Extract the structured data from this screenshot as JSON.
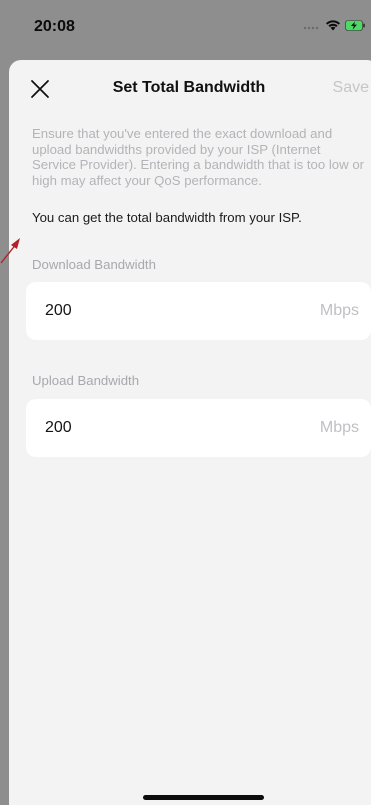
{
  "status_bar": {
    "time": "20:08",
    "icons": [
      "signal-icon",
      "wifi-icon",
      "battery-charging-icon"
    ]
  },
  "nav": {
    "close_icon": "close-icon",
    "title": "Set Total Bandwidth",
    "save_label": "Save"
  },
  "description": "Ensure that you've entered the exact download and upload bandwidths provided by your ISP (Internet Service Provider). Entering a bandwidth that is too low or high may affect your QoS performance.",
  "isp_note": "You can get the total bandwidth from your ISP.",
  "download": {
    "label": "Download Bandwidth",
    "value": "200",
    "unit": "Mbps"
  },
  "upload": {
    "label": "Upload Bandwidth",
    "value": "200",
    "unit": "Mbps"
  },
  "colors": {
    "accent_annotation": "#b3202a",
    "battery_green": "#4cd964",
    "save_disabled": "#c6c6c8",
    "background_dim": "#8e8e8e",
    "sheet": "#f3f3f4"
  }
}
